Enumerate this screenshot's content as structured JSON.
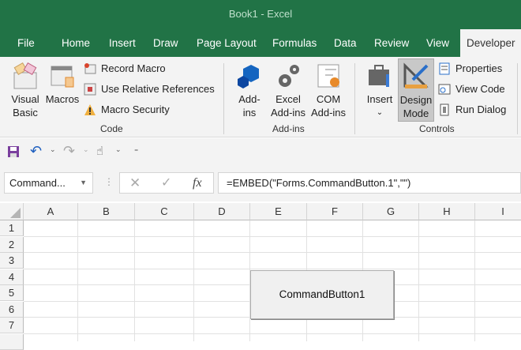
{
  "title": "Book1  -  Excel",
  "tabs": [
    "File",
    "Home",
    "Insert",
    "Draw",
    "Page Layout",
    "Formulas",
    "Data",
    "Review",
    "View",
    "Developer"
  ],
  "ribbon": {
    "code": {
      "visual_basic": [
        "Visual",
        "Basic"
      ],
      "macros": "Macros",
      "record_macro": "Record Macro",
      "relative_refs": "Use Relative References",
      "macro_security": "Macro Security",
      "label": "Code"
    },
    "addins": {
      "addins": [
        "Add-",
        "ins"
      ],
      "excel_addins": [
        "Excel",
        "Add-ins"
      ],
      "com_addins": [
        "COM",
        "Add-ins"
      ],
      "label": "Add-ins"
    },
    "controls": {
      "insert": "Insert",
      "design_mode": [
        "Design",
        "Mode"
      ],
      "properties": "Properties",
      "view_code": "View Code",
      "run_dialog": "Run Dialog",
      "label": "Controls"
    }
  },
  "name_box": "Command...",
  "formula": "=EMBED(\"Forms.CommandButton.1\",\"\")",
  "fx": "fx",
  "columns": [
    "A",
    "B",
    "C",
    "D",
    "E",
    "F",
    "G",
    "H",
    "I"
  ],
  "rows": [
    "1",
    "2",
    "3",
    "4",
    "5",
    "6",
    "7"
  ],
  "command_button": "CommandButton1",
  "colors": {
    "brand": "#217346",
    "ribbon": "#f3f3f3"
  }
}
